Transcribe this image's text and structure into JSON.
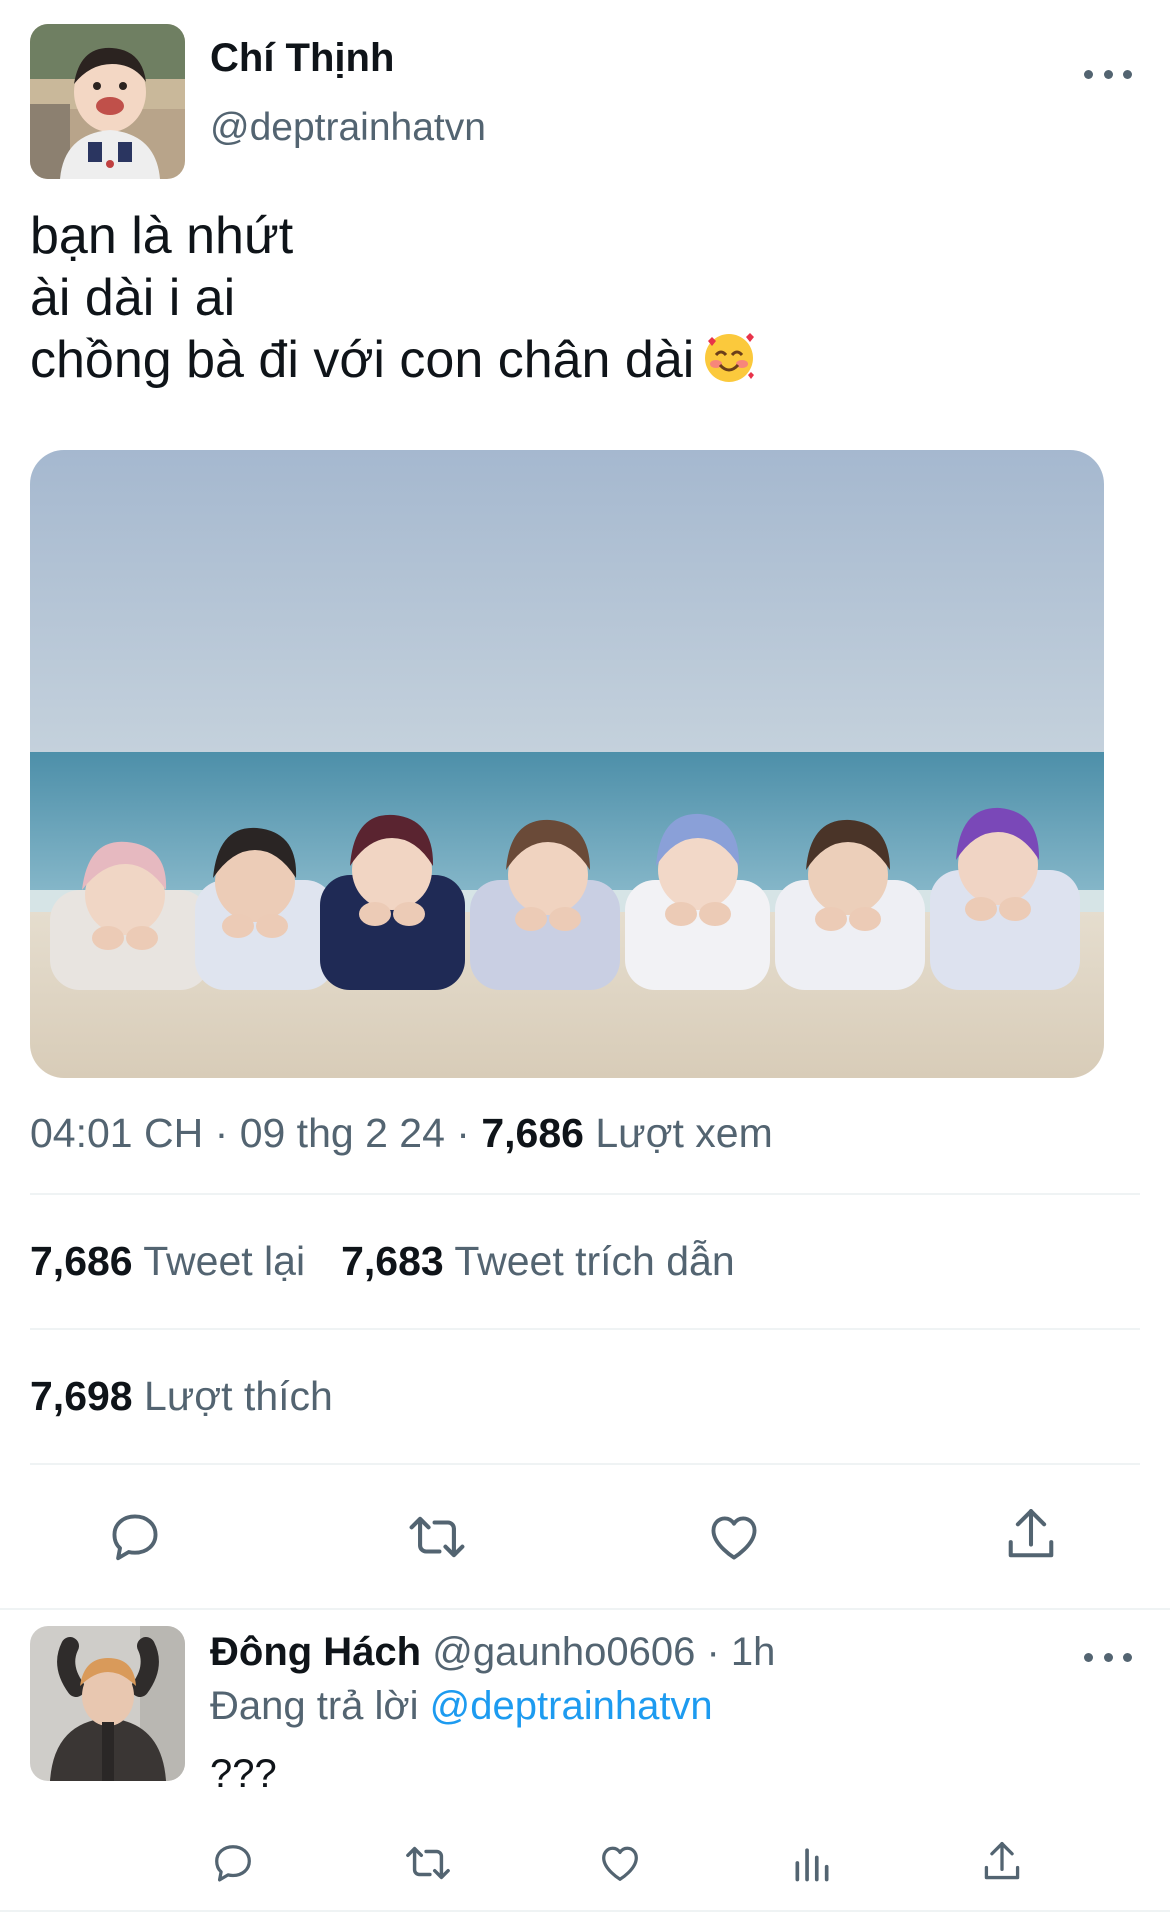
{
  "tweet": {
    "author": {
      "name": "Chí Thịnh",
      "handle": "@deptrainhatvn",
      "avatar": "child-portrait-avatar"
    },
    "text_lines": [
      "bạn là nhứt",
      "ài dài i ai",
      "chồng bà đi với con chân dài"
    ],
    "emoji": "smiling-face-with-hearts",
    "photo": "seven-people-lying-on-beach-photo",
    "time": "04:01 CH",
    "date": "09 thg 2 24",
    "views_count": "7,686",
    "views_label": "Lượt xem",
    "separator": "·",
    "retweets_count": "7,686",
    "retweets_label": "Tweet lại",
    "quotes_count": "7,683",
    "quotes_label": "Tweet trích dẫn",
    "likes_count": "7,698",
    "likes_label": "Lượt thích"
  },
  "actions": [
    "reply-icon",
    "retweet-icon",
    "like-icon",
    "share-icon"
  ],
  "reply": {
    "name": "Đông Hách",
    "handle": "@gaunho0606",
    "time": "1h",
    "replying_label": "Đang trả lời",
    "replying_to": "@deptrainhatvn",
    "text": "???",
    "avatar": "person-hands-on-head-avatar",
    "actions": [
      "reply-icon",
      "retweet-icon",
      "like-icon",
      "analytics-icon",
      "share-icon"
    ]
  },
  "colors": {
    "text": "#0f1419",
    "secondary": "#536471",
    "link": "#1d9bf0",
    "divider": "#eff3f4"
  }
}
